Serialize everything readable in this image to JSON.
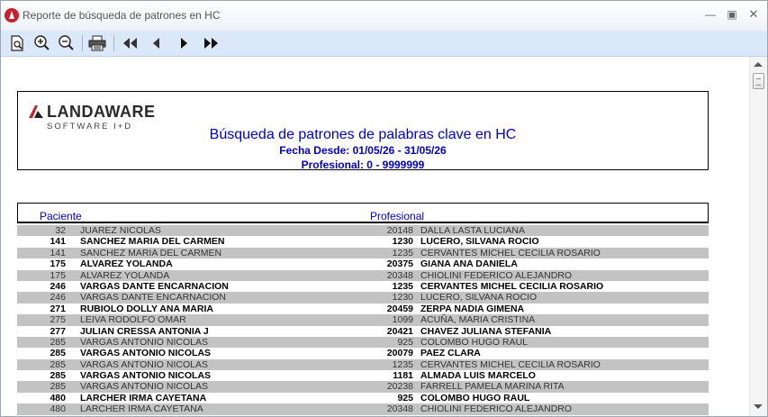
{
  "window": {
    "title": "Reporte de búsqueda de patrones en HC"
  },
  "toolbar": {
    "buttons": [
      {
        "name": "preview-icon"
      },
      {
        "name": "zoom-in-icon"
      },
      {
        "name": "zoom-out-icon"
      },
      {
        "name": "print-icon"
      },
      {
        "name": "first-page-icon"
      },
      {
        "name": "previous-page-icon"
      },
      {
        "name": "next-page-icon"
      },
      {
        "name": "last-page-icon"
      }
    ]
  },
  "logo": {
    "name": "LANDAWARE",
    "sub": "SOFTWARE I+D"
  },
  "report": {
    "title": "Búsqueda de patrones de palabras clave en HC",
    "fecha": "Fecha Desde: 01/05/26 - 31/05/26",
    "profesional": "Profesional: 0 - 9999999"
  },
  "columns": {
    "paciente": "Paciente",
    "profesional": "Profesional"
  },
  "rows": [
    {
      "pid": "32",
      "pname": "JUAREZ NICOLAS",
      "prid": "20148",
      "prname": "DALLA LASTA LUCIANA",
      "style": "gray"
    },
    {
      "pid": "141",
      "pname": "SANCHEZ MARIA DEL CARMEN",
      "prid": "1230",
      "prname": "LUCERO, SILVANA ROCIO",
      "style": "bold"
    },
    {
      "pid": "141",
      "pname": "SANCHEZ MARIA DEL CARMEN",
      "prid": "1235",
      "prname": "CERVANTES MICHEL CECILIA ROSARIO",
      "style": "gray"
    },
    {
      "pid": "175",
      "pname": "ALVAREZ YOLANDA",
      "prid": "20375",
      "prname": "GIANA ANA DANIELA",
      "style": "bold"
    },
    {
      "pid": "175",
      "pname": "ALVAREZ YOLANDA",
      "prid": "20348",
      "prname": "CHIOLINI FEDERICO ALEJANDRO",
      "style": "gray"
    },
    {
      "pid": "246",
      "pname": "VARGAS DANTE ENCARNACION",
      "prid": "1235",
      "prname": "CERVANTES MICHEL CECILIA ROSARIO",
      "style": "bold"
    },
    {
      "pid": "246",
      "pname": "VARGAS DANTE ENCARNACION",
      "prid": "1230",
      "prname": "LUCERO, SILVANA ROCIO",
      "style": "gray"
    },
    {
      "pid": "271",
      "pname": "RUBIOLO DOLLY ANA MARIA",
      "prid": "20459",
      "prname": "ZERPA NADIA GIMENA",
      "style": "bold"
    },
    {
      "pid": "275",
      "pname": "LEIVA RODOLFO OMAR",
      "prid": "1099",
      "prname": "ACUÑA, MARIA CRISTINA",
      "style": "gray"
    },
    {
      "pid": "277",
      "pname": "JULIAN CRESSA ANTONIA J",
      "prid": "20421",
      "prname": "CHAVEZ JULIANA STEFANIA",
      "style": "bold"
    },
    {
      "pid": "285",
      "pname": "VARGAS ANTONIO NICOLAS",
      "prid": "925",
      "prname": "COLOMBO HUGO RAUL",
      "style": "gray"
    },
    {
      "pid": "285",
      "pname": "VARGAS ANTONIO NICOLAS",
      "prid": "20079",
      "prname": "PAEZ CLARA",
      "style": "bold"
    },
    {
      "pid": "285",
      "pname": "VARGAS ANTONIO NICOLAS",
      "prid": "1235",
      "prname": "CERVANTES MICHEL CECILIA ROSARIO",
      "style": "gray"
    },
    {
      "pid": "285",
      "pname": "VARGAS ANTONIO NICOLAS",
      "prid": "1181",
      "prname": "ALMADA LUIS MARCELO",
      "style": "bold"
    },
    {
      "pid": "285",
      "pname": "VARGAS ANTONIO NICOLAS",
      "prid": "20238",
      "prname": "FARRELL PAMELA MARINA RITA",
      "style": "gray"
    },
    {
      "pid": "480",
      "pname": "LARCHER IRMA CAYETANA",
      "prid": "925",
      "prname": "COLOMBO HUGO RAUL",
      "style": "bold"
    },
    {
      "pid": "480",
      "pname": "LARCHER IRMA CAYETANA",
      "prid": "20348",
      "prname": "CHIOLINI FEDERICO ALEJANDRO",
      "style": "gray"
    }
  ]
}
